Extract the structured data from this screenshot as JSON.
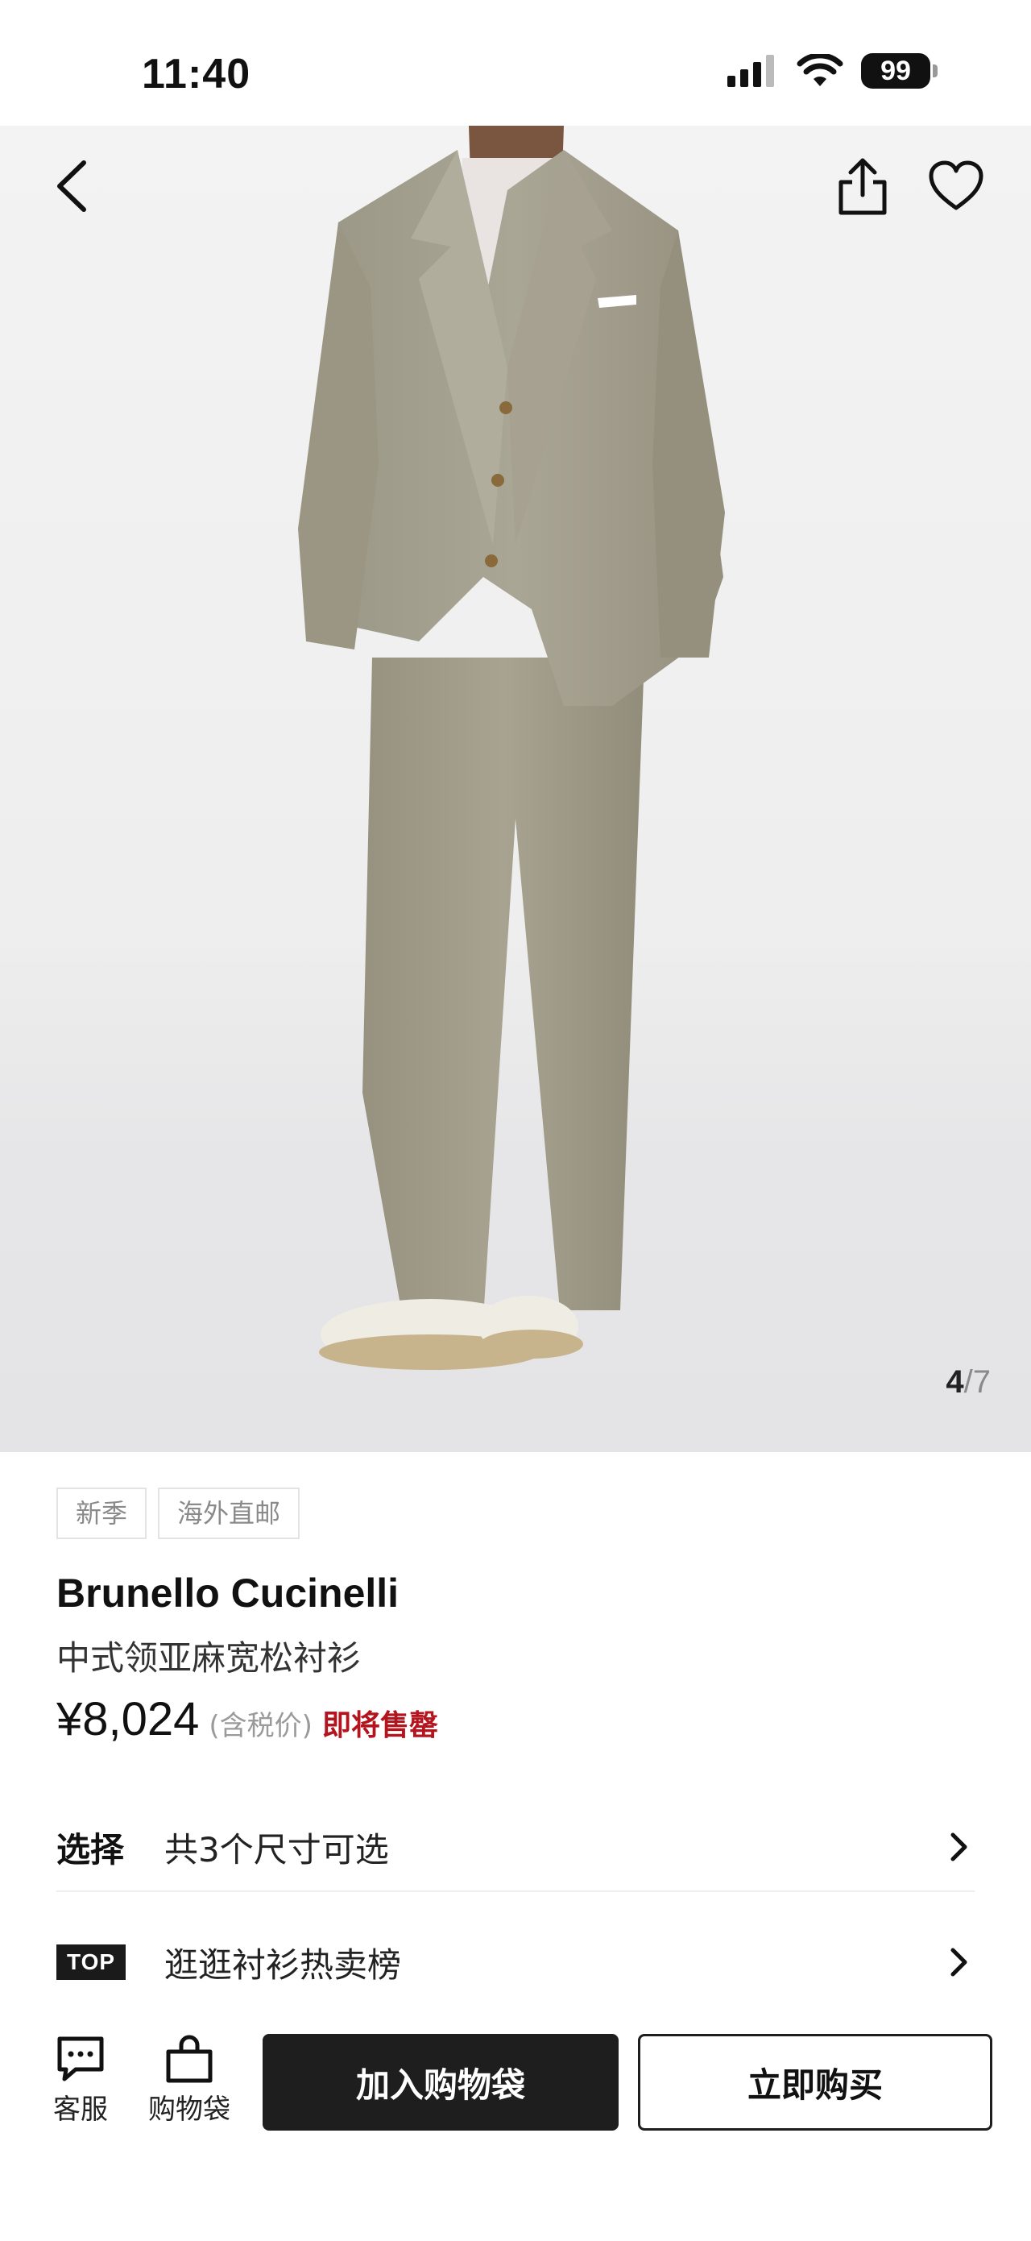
{
  "status_bar": {
    "time": "11:40",
    "battery": "99",
    "icons": [
      "signal-icon",
      "wifi-icon",
      "battery-icon"
    ]
  },
  "hero": {
    "icons": [
      "back-icon",
      "share-icon",
      "heart-icon"
    ],
    "page_current": "4",
    "page_separator": "/",
    "page_total": "7"
  },
  "product": {
    "tags": [
      "新季",
      "海外直邮"
    ],
    "brand": "Brunello Cucinelli",
    "name": "中式领亚麻宽松衬衫",
    "price": "¥8,024",
    "tax_note": "(含税价)",
    "stock_status": "即将售罄"
  },
  "options": {
    "size_label": "选择",
    "size_text": "共3个尺寸可选",
    "top_badge": "TOP",
    "top_text": "逛逛衬衫热卖榜"
  },
  "bottom_bar": {
    "service_label": "客服",
    "bag_label": "购物袋",
    "add_to_bag": "加入购物袋",
    "buy_now": "立即购买"
  },
  "colors": {
    "accent_red": "#b4141e",
    "primary_button": "#1e1e1e",
    "suit": "#a39f8f"
  }
}
